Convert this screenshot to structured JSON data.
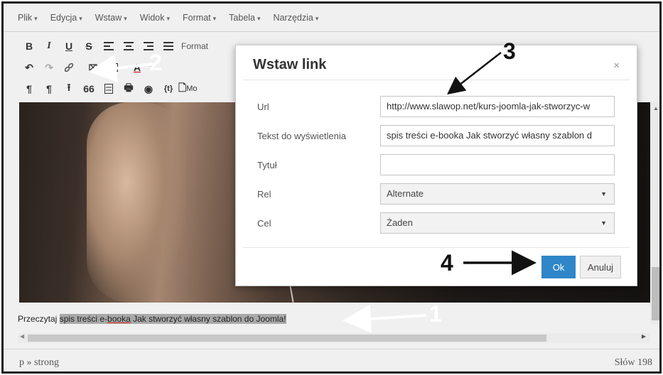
{
  "menubar": {
    "items": [
      {
        "label": "Plik"
      },
      {
        "label": "Edycja"
      },
      {
        "label": "Wstaw"
      },
      {
        "label": "Widok"
      },
      {
        "label": "Format"
      },
      {
        "label": "Tabela"
      },
      {
        "label": "Narzędzia"
      }
    ]
  },
  "toolbar": {
    "row1": {
      "bold": "B",
      "italic": "I",
      "underline": "U",
      "strike": "S",
      "format_label": "Format"
    },
    "row2": {
      "textcolor": "A"
    },
    "row3": {
      "para1": "¶",
      "para2": "¶",
      "quote": "66",
      "code": "{t}",
      "more": "Mo"
    }
  },
  "content": {
    "text_before": "Przeczytaj ",
    "selected_pre": "spis treści e-",
    "selected_ul": "booka",
    "selected_post": " Jak stworzyć własny szablon do Joomla!"
  },
  "status": {
    "path": "p » strong",
    "wordcount": "Słów 198"
  },
  "dialog": {
    "title": "Wstaw link",
    "close": "×",
    "fields": {
      "url_label": "Url",
      "url_value": "http://www.slawop.net/kurs-joomla-jak-stworzyc-w",
      "text_label": "Tekst do wyświetlenia",
      "text_value": "spis treści e-booka Jak stworzyć własny szablon d",
      "title_label": "Tytuł",
      "title_value": "",
      "rel_label": "Rel",
      "rel_value": "Alternate",
      "target_label": "Cel",
      "target_value": "Żaden"
    },
    "ok": "Ok",
    "cancel": "Anuluj"
  },
  "annotations": {
    "n1": "1",
    "n2": "2",
    "n3": "3",
    "n4": "4"
  },
  "colors": {
    "ok_button": "#2f86c8",
    "selection": "#a9a9a9"
  }
}
